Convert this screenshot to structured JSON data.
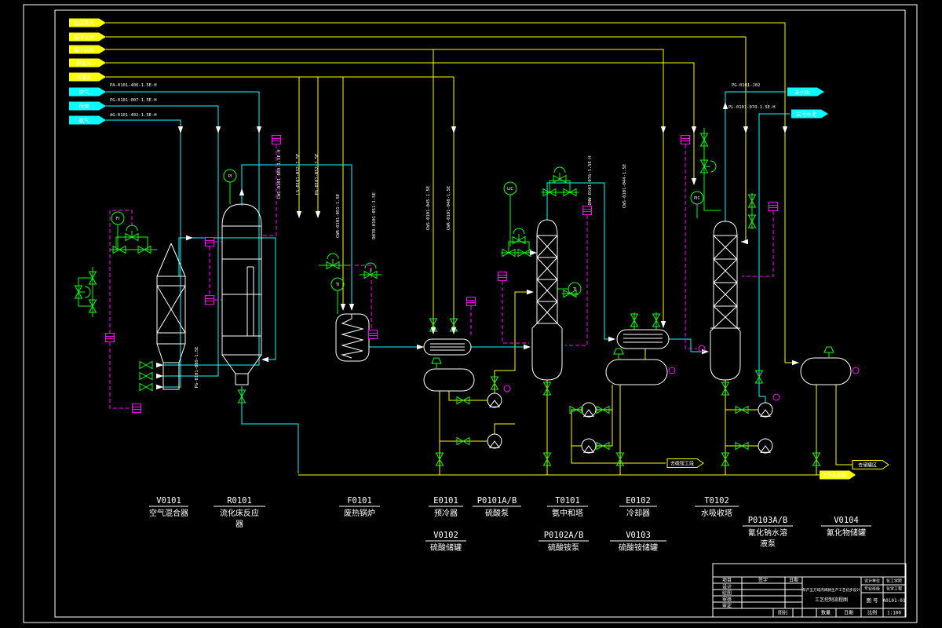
{
  "drawing": {
    "left_flags_yellow": [
      {
        "label": "低压蒸汽"
      },
      {
        "label": "循环上水"
      },
      {
        "label": "循环回水"
      },
      {
        "label": "脱盐水"
      },
      {
        "label": "冷凝水"
      }
    ],
    "left_flags_cyan": [
      {
        "label": "空气",
        "pipe_code": "PA-0101-400-1.5E-H"
      },
      {
        "label": "丙烯",
        "pipe_code": "PG-0101-007-1.5E-H"
      },
      {
        "label": "氨气",
        "pipe_code": "AG-0101-402-1.5E-H"
      }
    ],
    "right_flags": [
      {
        "label": "去火炬",
        "pipe_code": "PG-0101-J02"
      },
      {
        "label": "去污水池",
        "pipe_code": "PL-0101-070-1.5E-H"
      }
    ],
    "bottom_flags": [
      {
        "label": "去硫铵工段"
      },
      {
        "label": "去储罐区"
      },
      {
        "label": "去污水处理"
      }
    ],
    "pipe_labels_vertical": [
      "CWS-0101-089-1.5E-H",
      "LS-0101-032-1.5E",
      "PG-0101-052-1.5E",
      "CWR-0101-051-1.5E",
      "DN70-0101-051-1.5E",
      "CWS-0101-045-1.5E",
      "CWR-0101-048-1.5E",
      "DNW-0101-076-1.5E-H",
      "CWS-0101-044-1.5E",
      "PG-0101-089-1.5E"
    ],
    "instruments": {
      "i1": "PI",
      "i2": "FI",
      "i3": "TI",
      "i4": "LIC",
      "i5": "TI",
      "i6": "PIC"
    },
    "equipment": [
      {
        "id": "V0101",
        "name": "空气混合器"
      },
      {
        "id": "R0101",
        "name": "流化床反应",
        "name2": "器"
      },
      {
        "id": "F0101",
        "name": "废热锅炉"
      },
      {
        "id": "E0101",
        "name": "预冷器"
      },
      {
        "id": "P0101A/B",
        "name": "硫酸泵"
      },
      {
        "id": "T0101",
        "name": "氨中和塔"
      },
      {
        "id": "E0102",
        "name": "冷却器"
      },
      {
        "id": "T0102",
        "name": "水吸收塔"
      },
      {
        "id": "V0102",
        "name": "硫酸储罐"
      },
      {
        "id": "P0102A/B",
        "name": "硫酸铵泵"
      },
      {
        "id": "V0103",
        "name": "硫酸铵储罐"
      },
      {
        "id": "P0103A/B",
        "name": "氰化钠水溶",
        "name2": "液泵"
      },
      {
        "id": "V0104",
        "name": "氰化物储罐"
      }
    ],
    "title_block": {
      "col_item": "项目",
      "col_sign": "签字",
      "col_date": "日期",
      "rows": [
        "设计",
        "绘图",
        "审核",
        "审定"
      ],
      "title_line1": "年产五万吨丙烯腈生产工艺初步设计",
      "title_line2": "工艺控制流程图",
      "r1_label": "设计单位",
      "r1_value": "化工学院",
      "r2_label": "专业班级",
      "r2_value": "化学工程",
      "drawing_no_label": "图 号",
      "drawing_no": "A0101-01",
      "type_label": "图别",
      "qty_label": "数量",
      "date_label": "日期",
      "scale_label": "比例",
      "scale": "1:100"
    }
  }
}
